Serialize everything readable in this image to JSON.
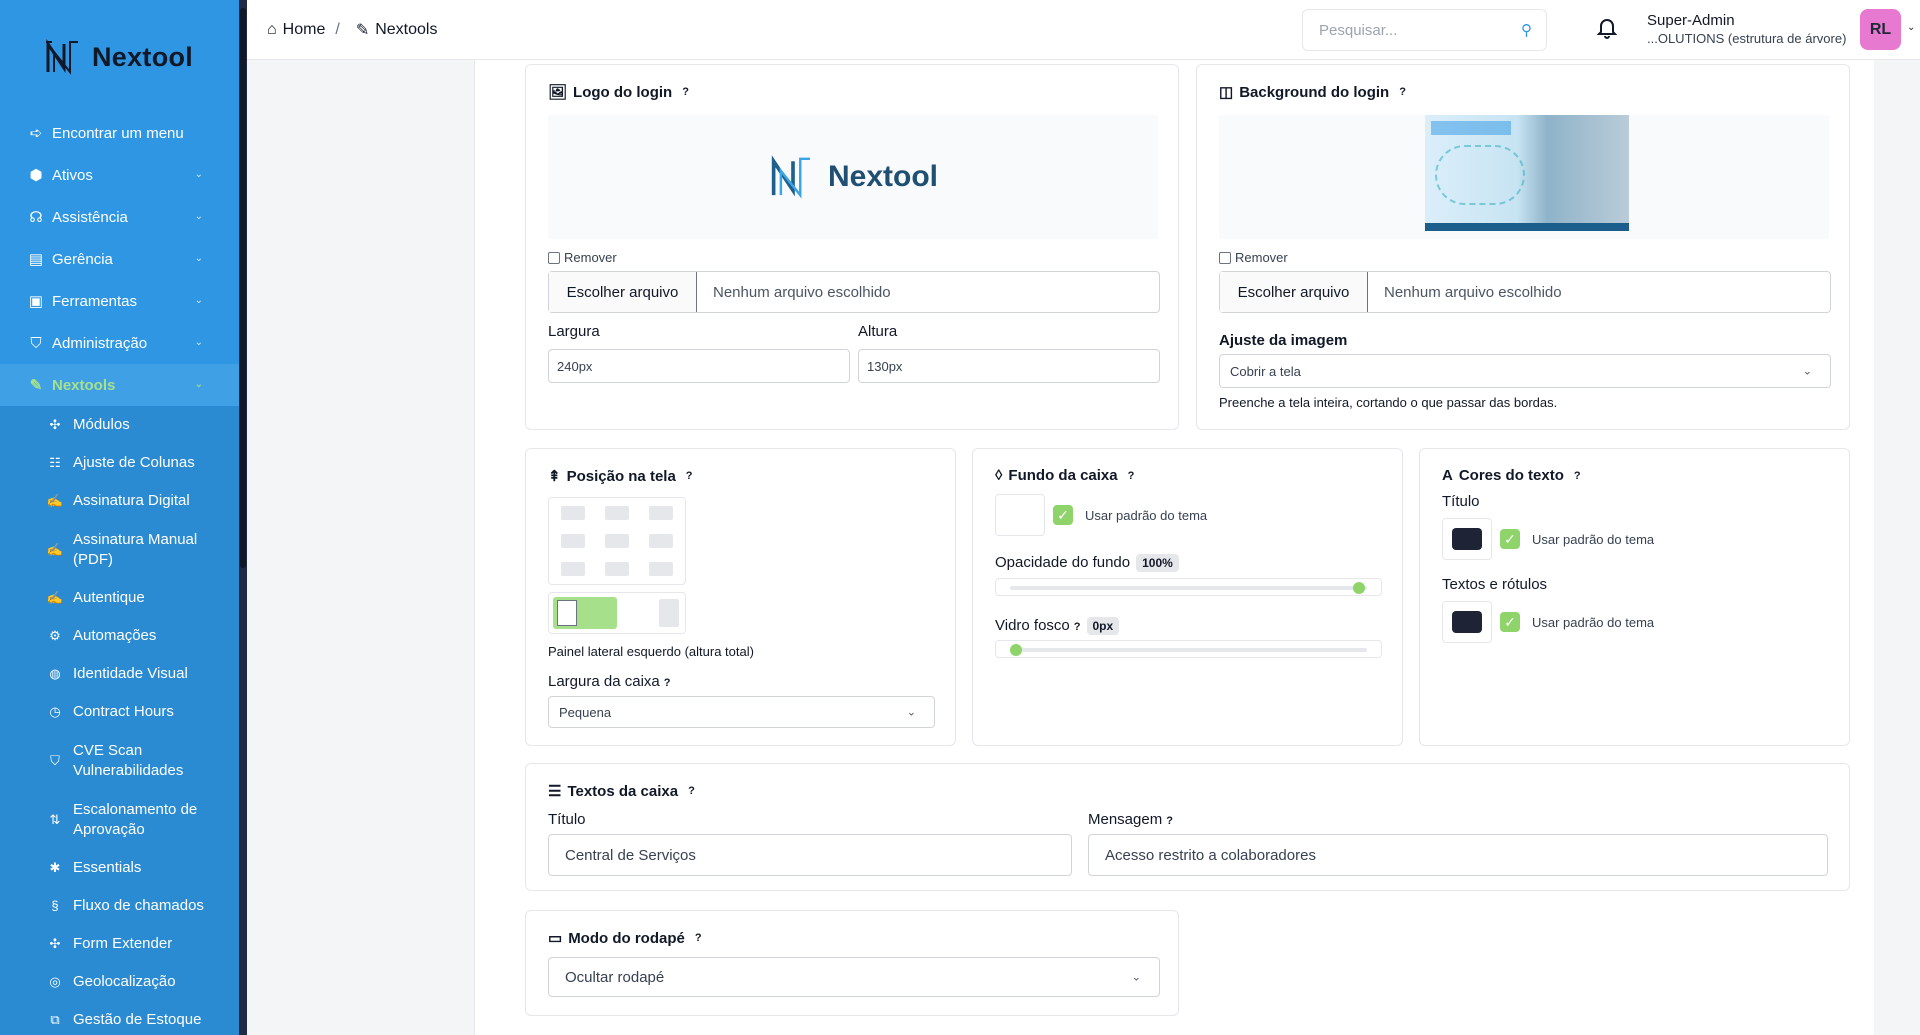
{
  "brand": {
    "name": "Nextool"
  },
  "sidebar": {
    "items": [
      {
        "label": "Encontrar um menu",
        "icon": "arrow-right-icon"
      },
      {
        "label": "Ativos",
        "icon": "cube-icon"
      },
      {
        "label": "Assistência",
        "icon": "headset-icon"
      },
      {
        "label": "Gerência",
        "icon": "wallet-icon"
      },
      {
        "label": "Ferramentas",
        "icon": "briefcase-icon"
      },
      {
        "label": "Administração",
        "icon": "shield-icon"
      },
      {
        "label": "Nextools",
        "icon": "wrench-icon"
      }
    ],
    "subitems": [
      {
        "label": "Módulos",
        "icon": "puzzle-icon"
      },
      {
        "label": "Ajuste de Colunas",
        "icon": "columns-icon"
      },
      {
        "label": "Assinatura Digital",
        "icon": "signature-icon"
      },
      {
        "label": "Assinatura Manual (PDF)",
        "icon": "signature-icon"
      },
      {
        "label": "Autentique",
        "icon": "signature-icon"
      },
      {
        "label": "Automações",
        "icon": "cog-icon"
      },
      {
        "label": "Identidade Visual",
        "icon": "palette-icon"
      },
      {
        "label": "Contract Hours",
        "icon": "clock-icon"
      },
      {
        "label": "CVE Scan Vulnerabilidades",
        "icon": "shield-icon"
      },
      {
        "label": "Escalonamento de Aprovação",
        "icon": "arrows-updown-icon"
      },
      {
        "label": "Essentials",
        "icon": "bug-icon"
      },
      {
        "label": "Fluxo de chamados",
        "icon": "route-icon"
      },
      {
        "label": "Form Extender",
        "icon": "puzzle-icon"
      },
      {
        "label": "Geolocalização",
        "icon": "location-icon"
      },
      {
        "label": "Gestão de Estoque",
        "icon": "boxes-icon"
      }
    ]
  },
  "header": {
    "home": "Home",
    "sep": "/",
    "current": "Nextools",
    "search_placeholder": "Pesquisar...",
    "user_role": "Super-Admin",
    "user_org": "...OLUTIONS (estrutura de árvore)",
    "avatar": "RL"
  },
  "logo_card": {
    "title": "Logo do login",
    "help": "?",
    "remove": "Remover",
    "file_button": "Escolher arquivo",
    "file_text": "Nenhum arquivo escolhido",
    "width_label": "Largura",
    "width_value": "240px",
    "height_label": "Altura",
    "height_value": "130px"
  },
  "bg_card": {
    "title": "Background do login",
    "help": "?",
    "remove": "Remover",
    "file_button": "Escolher arquivo",
    "file_text": "Nenhum arquivo escolhido",
    "fit_label": "Ajuste da imagem",
    "fit_value": "Cobrir a tela",
    "fit_hint": "Preenche a tela inteira, cortando o que passar das bordas."
  },
  "position_card": {
    "title": "Posição na tela",
    "help": "?",
    "caption": "Painel lateral esquerdo (altura total)",
    "box_width_label": "Largura da caixa",
    "box_width_value": "Pequena"
  },
  "background_card": {
    "title": "Fundo da caixa",
    "help": "?",
    "use_theme": "Usar padrão do tema",
    "opacity_label": "Opacidade do fundo",
    "opacity_value": "100%",
    "opacity_level": 1.0,
    "blur_label": "Vidro fosco",
    "blur_value": "0px",
    "blur_level": 0.0
  },
  "text_colors_card": {
    "title": "Cores do texto",
    "help": "?",
    "title_label": "Título",
    "title_use_theme": "Usar padrão do tema",
    "labels_label": "Textos e rótulos",
    "labels_use_theme": "Usar padrão do tema",
    "swatch_color": "#1e2435"
  },
  "box_texts_card": {
    "title": "Textos da caixa",
    "help": "?",
    "title_label": "Título",
    "title_value": "Central de Serviços",
    "message_label": "Mensagem",
    "message_value": "Acesso restrito a colaboradores"
  },
  "footer_card": {
    "title": "Modo do rodapé",
    "help": "?",
    "value": "Ocultar rodapé"
  },
  "colors": {
    "sidebar": "#2e96e3",
    "accent": "#8fd46a",
    "avatar": "#e879d0"
  }
}
